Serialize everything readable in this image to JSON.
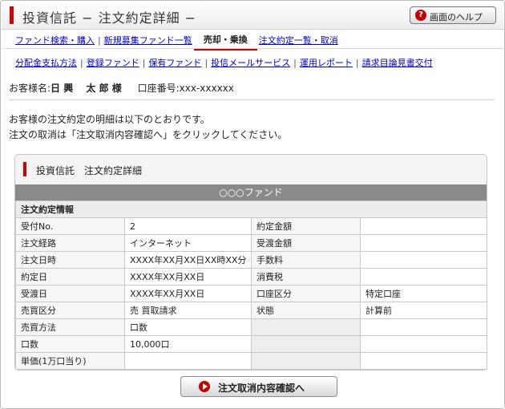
{
  "header": {
    "title": "投資信託 − 注文約定詳細 −",
    "help_button": "画面のヘルプ",
    "help_icon": "question-icon"
  },
  "nav1": [
    {
      "label": "ファンド検索・購入",
      "active": false
    },
    {
      "label": "新規募集ファンド一覧",
      "active": false
    },
    {
      "label": "売却・乗換",
      "active": true
    },
    {
      "label": "注文約定一覧・取消",
      "active": false
    }
  ],
  "nav2": [
    {
      "label": "分配金支払方法"
    },
    {
      "label": "登録ファンド"
    },
    {
      "label": "保有ファンド"
    },
    {
      "label": "投信メールサービス"
    },
    {
      "label": "運用レポート"
    },
    {
      "label": "請求目論見書交付"
    }
  ],
  "customer": {
    "name_label": "お客様名:",
    "name": "日 興　 太 郎 様",
    "account_label": "口座番号:",
    "account": "xxx-xxxxxx"
  },
  "messages": [
    "お客様の注文約定の明細は以下のとおりです。",
    "注文の取消は「注文取消内容確認へ」をクリックしてください。"
  ],
  "panel": {
    "title": "投資信託　注文約定詳細",
    "fund_name": "○○○ファンド",
    "section_title": "注文約定情報",
    "rows": [
      {
        "l1": "受付No.",
        "v1": "2",
        "l2": "約定金額",
        "v2": ""
      },
      {
        "l1": "注文経路",
        "v1": "インターネット",
        "l2": "受渡金額",
        "v2": ""
      },
      {
        "l1": "注文日時",
        "v1": "XXXX年XX月XX日XX時XX分",
        "l2": "手数料",
        "v2": ""
      },
      {
        "l1": "約定日",
        "v1": "XXXX年XX月XX日",
        "l2": "消費税",
        "v2": ""
      },
      {
        "l1": "受渡日",
        "v1": "XXXX年XX月XX日",
        "l2": "口座区分",
        "v2": "特定口座"
      },
      {
        "l1": "売買区分",
        "v1": "売 買取請求",
        "l2": "状態",
        "v2": "計算前"
      },
      {
        "l1": "売買方法",
        "v1": "口数",
        "l2": "",
        "v2": ""
      },
      {
        "l1": "口数",
        "v1": "10,000口",
        "l2": "",
        "v2": ""
      },
      {
        "l1": "単価(1万口当り)",
        "v1": "",
        "l2": "",
        "v2": ""
      }
    ]
  },
  "actions": {
    "cancel_button": "注文取消内容確認へ"
  },
  "colors": {
    "accent": "#d40000",
    "link": "#0000cc",
    "fund_bar": "#8a8a8a"
  }
}
